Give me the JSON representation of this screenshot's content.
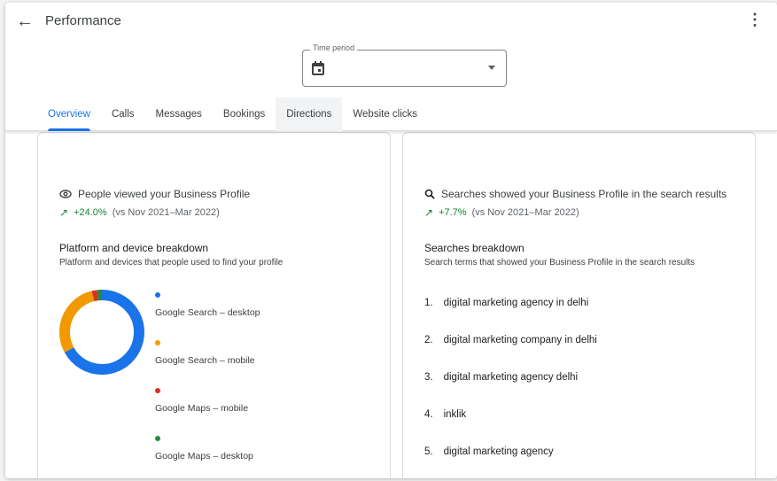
{
  "header": {
    "title": "Performance",
    "back_icon": "arrow-left",
    "more_icon": "more-vert"
  },
  "time_period": {
    "label": "Time period",
    "value": ""
  },
  "tabs": [
    {
      "label": "Overview"
    },
    {
      "label": "Calls"
    },
    {
      "label": "Messages"
    },
    {
      "label": "Bookings"
    },
    {
      "label": "Directions"
    },
    {
      "label": "Website clicks"
    }
  ],
  "views": {
    "title": "People viewed your Business Profile",
    "delta": "+24.0%",
    "compare": "(vs Nov 2021–Mar 2022)",
    "section_title": "Platform and device breakdown",
    "section_sub": "Platform and devices that people used to find your profile",
    "breakdown": [
      {
        "label": "Google Search – desktop",
        "color": "#1a73e8",
        "share": 0.67
      },
      {
        "label": "Google Search – mobile",
        "color": "#f29900",
        "share": 0.29
      },
      {
        "label": "Google Maps – mobile",
        "color": "#d93025",
        "share": 0.02
      },
      {
        "label": "Google Maps – desktop",
        "color": "#1e8e3e",
        "share": 0.02
      }
    ]
  },
  "searches": {
    "title": "Searches showed your Business Profile in the search results",
    "delta": "+7.7%",
    "compare": "(vs Nov 2021–Mar 2022)",
    "section_title": "Searches breakdown",
    "section_sub": "Search terms that showed your Business Profile in the search results",
    "terms": [
      {
        "rank": "1.",
        "term": "digital marketing agency in delhi"
      },
      {
        "rank": "2.",
        "term": "digital marketing company in delhi"
      },
      {
        "rank": "3.",
        "term": "digital marketing agency delhi"
      },
      {
        "rank": "4.",
        "term": "inklik"
      },
      {
        "rank": "5.",
        "term": "digital marketing agency"
      }
    ]
  }
}
